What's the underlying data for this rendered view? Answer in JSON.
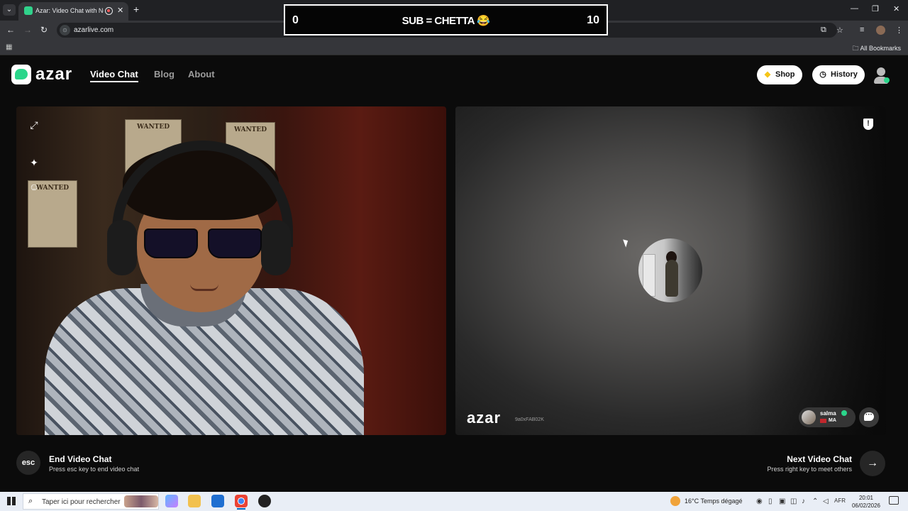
{
  "browser": {
    "tab_list_icon": "⌄",
    "tab_title": "Azar: Video Chat with New",
    "tab_close": "✕",
    "new_tab": "+",
    "window_controls": [
      "—",
      "❐",
      "✕"
    ],
    "back": "←",
    "forward": "→",
    "reload": "↻",
    "url": "azarlive.com",
    "bookmark_star": "☆",
    "all_bookmarks": "All Bookmarks"
  },
  "overlay": {
    "left_count": "0",
    "center_text": "SUB = CHETTA 😂",
    "right_count": "10"
  },
  "site": {
    "logo_text": "azar",
    "nav": [
      {
        "label": "Video Chat",
        "active": true
      },
      {
        "label": "Blog",
        "active": false
      },
      {
        "label": "About",
        "active": false
      }
    ],
    "shop_label": "Shop",
    "history_label": "History"
  },
  "left_video": {
    "poster_texts": [
      "WANTED",
      "WANTED",
      "WANTED"
    ],
    "tools": [
      "expand-icon",
      "magic-wand-icon",
      "sticker-icon"
    ]
  },
  "right_video": {
    "watermark_logo": "azar",
    "watermark_id": "9a0xFAB02K",
    "partner_name": "salma",
    "partner_country": "MA"
  },
  "controls": {
    "esc_label": "esc",
    "end_title": "End Video Chat",
    "end_subtitle": "Press esc key to end video chat",
    "next_title": "Next Video Chat",
    "next_subtitle": "Press right key to meet others",
    "next_arrow": "→"
  },
  "taskbar": {
    "search_placeholder": "Taper ici pour rechercher",
    "weather": "16°C  Temps dégagé",
    "lang": "AFR",
    "time": "20:01",
    "date": "06/02/2026"
  }
}
